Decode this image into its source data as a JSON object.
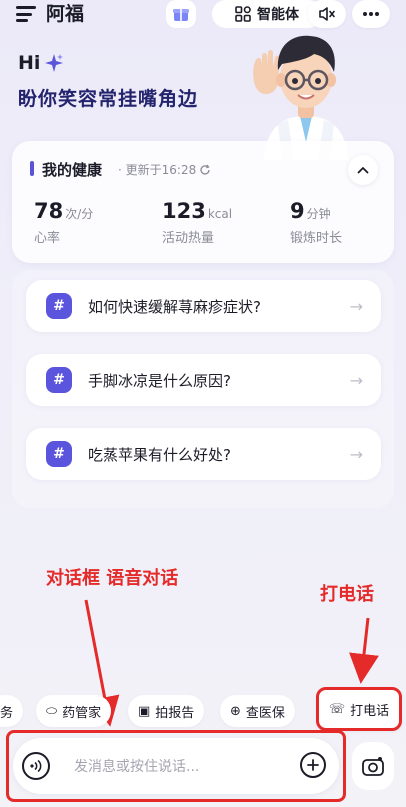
{
  "header": {
    "title": "阿福",
    "agent_label": "智能体"
  },
  "greeting": {
    "hi": "Hi",
    "slogan": "盼你笑容常挂嘴角边"
  },
  "health": {
    "title": "我的健康",
    "update_text": "· 更新于16:28",
    "metrics": [
      {
        "value": "78",
        "unit": "次/分",
        "label": "心率"
      },
      {
        "value": "123",
        "unit": "kcal",
        "label": "活动热量"
      },
      {
        "value": "9",
        "unit": "分钟",
        "label": "锻炼时长"
      }
    ]
  },
  "questions": [
    {
      "text": "如何快速缓解荨麻疹症状?"
    },
    {
      "text": "手脚冰凉是什么原因?"
    },
    {
      "text": "吃蒸苹果有什么好处?"
    }
  ],
  "annotations": {
    "dialog_label": "对话框 语音对话",
    "call_label": "打电话"
  },
  "chips": [
    {
      "icon": "task-icon",
      "label": "务"
    },
    {
      "icon": "pill-icon",
      "label": "药管家"
    },
    {
      "icon": "report-icon",
      "label": "拍报告"
    },
    {
      "icon": "insurance-icon",
      "label": "查医保"
    },
    {
      "icon": "phone-icon",
      "label": "打电话"
    }
  ],
  "input": {
    "placeholder": "发消息或按住说话..."
  },
  "colors": {
    "accent": "#5b55dd",
    "annotation_red": "#e52a2a",
    "background": "#eceaf8"
  }
}
